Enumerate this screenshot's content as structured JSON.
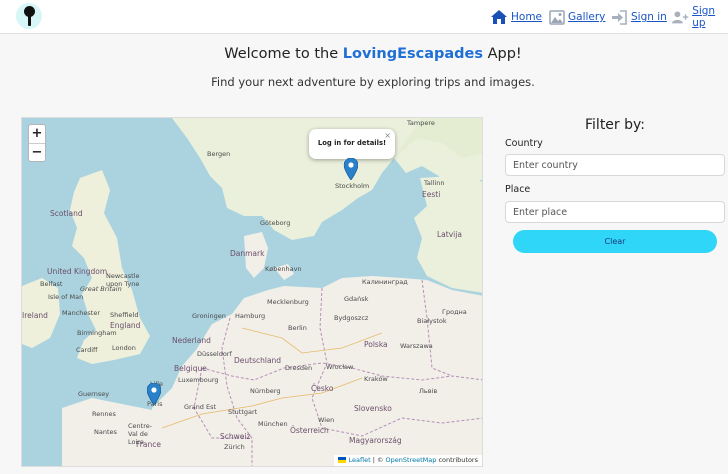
{
  "nav": {
    "home": "Home",
    "gallery": "Gallery",
    "signin": "Sign in",
    "signup": "Sign up"
  },
  "hero": {
    "welcome_prefix": "Welcome to the",
    "brand": "LovingEscapades",
    "welcome_suffix": "App!",
    "subtitle": "Find your next adventure by exploring trips and images."
  },
  "map": {
    "zoom_in": "+",
    "zoom_out": "−",
    "popup_text": "Log in for details!",
    "popup_close": "×",
    "attribution_leaflet": "Leaflet",
    "attribution_sep": "| ©",
    "attribution_osm": "OpenStreetMap",
    "attribution_suffix": "contributors",
    "labels": {
      "tampere": "Tampere",
      "bergen": "Bergen",
      "stockholm": "Stockholm",
      "tallinn": "Tallinn",
      "eesti": "Eesti",
      "latvija": "Latvija",
      "goteborg": "Göteborg",
      "danmark": "Danmark",
      "kobenhavn": "København",
      "scotland": "Scotland",
      "united_kingdom": "United Kingdom",
      "newcastle": "Newcastle upon Tyne",
      "belfast": "Belfast",
      "isle_of_man": "Isle of Man",
      "great_britain": "Great Britain",
      "manchester": "Manchester",
      "sheffield": "Sheffield",
      "england": "England",
      "birmingham": "Birmingham",
      "ireland": "Ireland",
      "cardiff": "Cardiff",
      "london": "London",
      "gdansk": "Gdańsk",
      "hamburg": "Hamburg",
      "groningen": "Groningen",
      "nederland": "Nederland",
      "berlin": "Berlin",
      "bydgoszcz": "Bydgoszcz",
      "bialystok": "Białystok",
      "hrodna": "Гродна",
      "mecklenburg": "Mecklenburg",
      "dusseldorf": "Düsseldorf",
      "deutschland": "Deutschland",
      "polska": "Polska",
      "warszawa": "Warszawa",
      "belgique": "Belgique",
      "lille": "Lille",
      "dresden": "Dresden",
      "wroclaw": "Wrocław",
      "krakow": "Kraków",
      "luxembourg": "Luxembourg",
      "nurnberg": "Nürnberg",
      "cesko": "Česko",
      "lviv": "Львів",
      "guernsey": "Guernsey",
      "paris": "Paris",
      "stuttgart": "Stuttgart",
      "slovensko": "Slovensko",
      "rennes": "Rennes",
      "grand_est": "Grand Est",
      "munchen": "München",
      "wien": "Wien",
      "nantes": "Nantes",
      "magyarorszag": "Magyarország",
      "france": "France",
      "schweiz": "Schweiz",
      "osterreich": "Österreich",
      "zurich": "Zürich",
      "centre": "Centre-Val de Loire",
      "kaliningrad": "Калининград"
    }
  },
  "filter": {
    "title": "Filter by:",
    "country_label": "Country",
    "country_placeholder": "Enter country",
    "country_value": "",
    "place_label": "Place",
    "place_placeholder": "Enter place",
    "place_value": "",
    "clear_label": "Clear"
  },
  "colors": {
    "accent": "#1f6fd4",
    "button": "#2fd6f8",
    "marker": "#2a81cb",
    "water": "#aad3df",
    "land": "#f2efe9"
  }
}
